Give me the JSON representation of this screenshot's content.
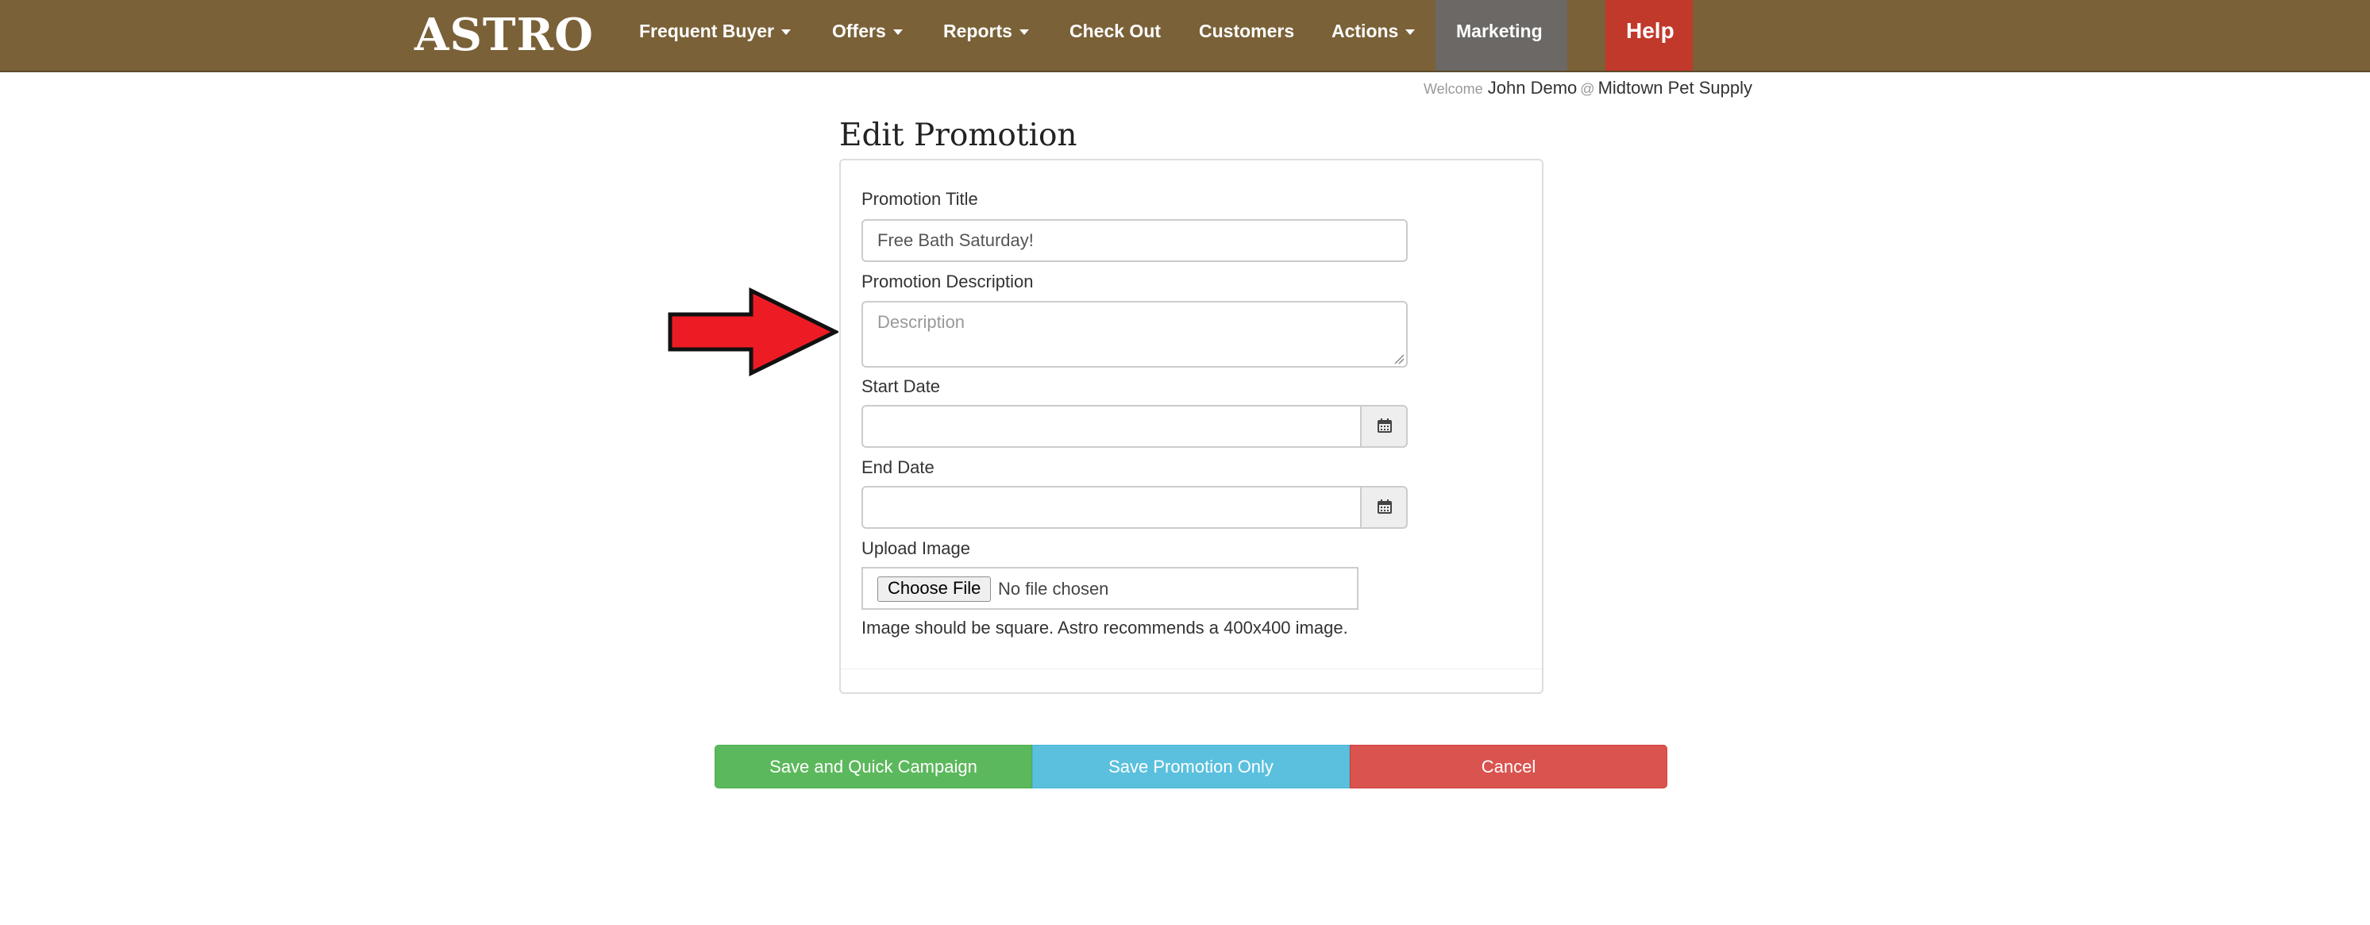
{
  "navbar": {
    "logo": "ASTRO",
    "items": [
      {
        "label": "Frequent Buyer",
        "dropdown": true
      },
      {
        "label": "Offers",
        "dropdown": true
      },
      {
        "label": "Reports",
        "dropdown": true
      },
      {
        "label": "Check Out",
        "dropdown": false
      },
      {
        "label": "Customers",
        "dropdown": false
      },
      {
        "label": "Actions",
        "dropdown": true
      },
      {
        "label": "Marketing",
        "dropdown": false,
        "active": true
      }
    ],
    "help_label": "Help",
    "colors": {
      "bar": "#7a6138",
      "active": "#6b6866",
      "help": "#c0392b"
    }
  },
  "welcome": {
    "prefix": "Welcome",
    "user": "John Demo",
    "at": "@",
    "store": "Midtown Pet Supply"
  },
  "page": {
    "title": "Edit Promotion"
  },
  "form": {
    "title_label": "Promotion Title",
    "title_value": "Free Bath Saturday!",
    "description_label": "Promotion Description",
    "description_placeholder": "Description",
    "start_date_label": "Start Date",
    "start_date_value": "",
    "end_date_label": "End Date",
    "end_date_value": "",
    "upload_label": "Upload Image",
    "choose_file_label": "Choose File",
    "file_status": "No file chosen",
    "image_help": "Image should be square. Astro recommends a 400x400 image."
  },
  "annotation": {
    "icon": "red-arrow-icon",
    "color": "#ed1c24"
  },
  "buttons": {
    "save_campaign": "Save and Quick Campaign",
    "save_only": "Save Promotion Only",
    "cancel": "Cancel",
    "colors": {
      "green": "#5cb85c",
      "blue": "#5bc0de",
      "red": "#d9534f"
    }
  }
}
